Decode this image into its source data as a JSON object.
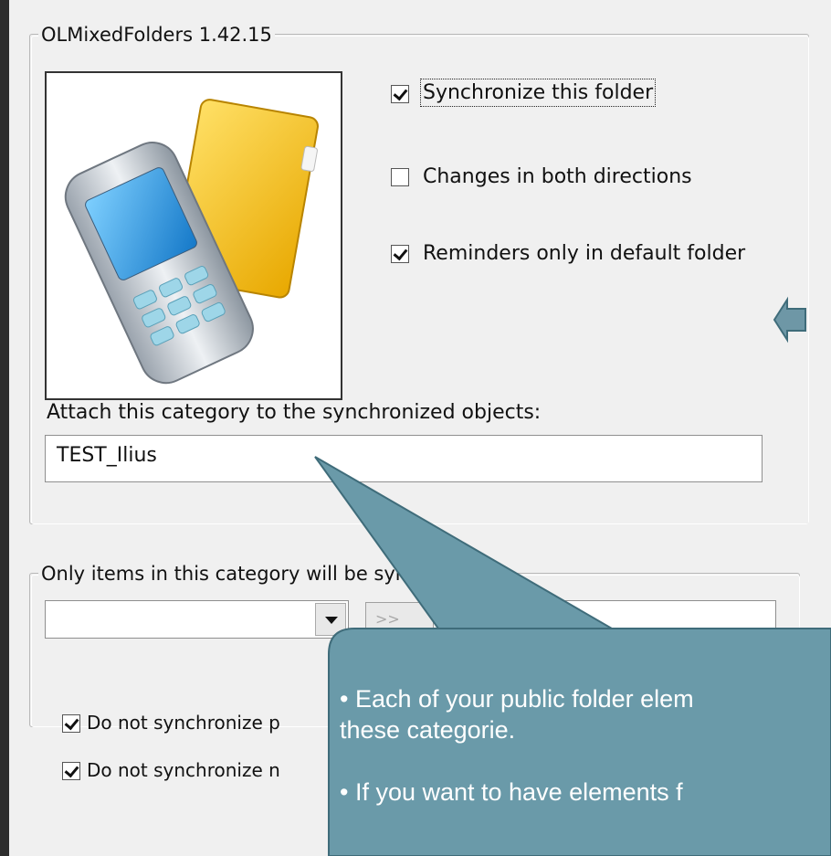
{
  "group1": {
    "title": "OLMixedFolders 1.42.15",
    "checkboxes": [
      {
        "label": "Synchronize this folder",
        "checked": true
      },
      {
        "label": "Changes in both directions",
        "checked": false
      },
      {
        "label": "Reminders only in default folder",
        "checked": true
      }
    ],
    "category_label": "Attach this category to the synchronized objects:",
    "category_value": "TEST_Ilius"
  },
  "group2": {
    "title": "Only items in this category will be synchronized",
    "add_button": ">>",
    "checkboxes": [
      {
        "label": "Do not synchronize p",
        "checked": true
      },
      {
        "label": "Do not synchronize n",
        "checked": true
      }
    ]
  },
  "callout": {
    "line1": "• Each of your public folder elem",
    "line2": "these categorie.",
    "line3": "• If you want to have elements f"
  },
  "colors": {
    "callout_fill": "#6a9aa9",
    "callout_stroke": "#3f6c7a",
    "arrow_fill": "#6e97a6",
    "background": "#2d2d2d"
  }
}
